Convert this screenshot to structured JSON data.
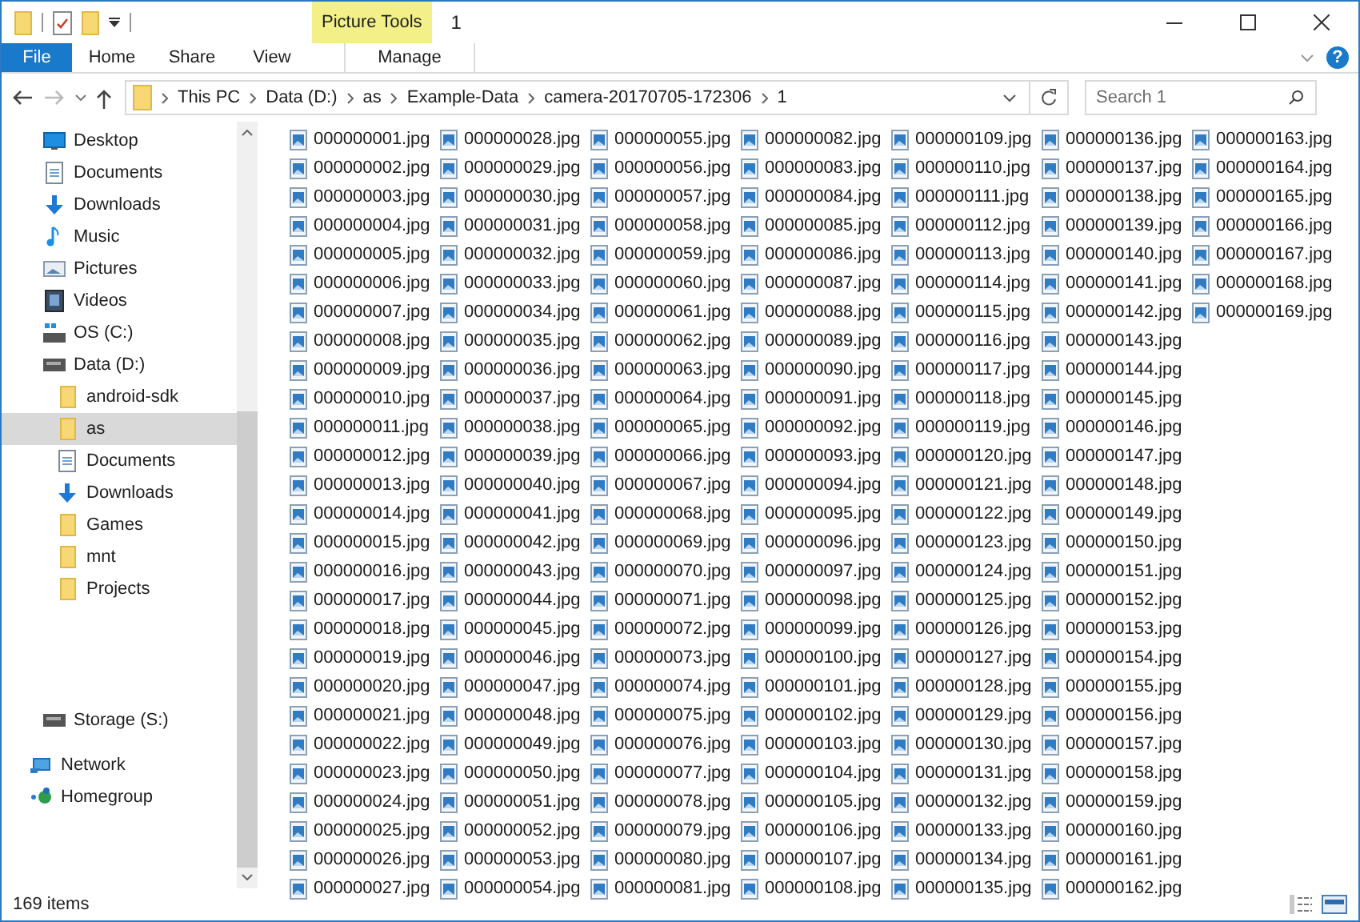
{
  "window": {
    "title": "1",
    "context_group": "Picture Tools",
    "help": "?"
  },
  "ribbon_tabs": [
    {
      "label": "File",
      "kind": "file"
    },
    {
      "label": "Home",
      "kind": "tab"
    },
    {
      "label": "Share",
      "kind": "tab"
    },
    {
      "label": "View",
      "kind": "tab"
    },
    {
      "label": "Manage",
      "kind": "context"
    }
  ],
  "address": {
    "breadcrumbs": [
      "This PC",
      "Data (D:)",
      "as",
      "Example-Data",
      "camera-20170705-172306",
      "1"
    ]
  },
  "search": {
    "placeholder": "Search 1"
  },
  "nav": {
    "groups": [
      {
        "items": [
          {
            "label": "Desktop",
            "kind": "desktop",
            "selected": false
          },
          {
            "label": "Documents",
            "kind": "document",
            "selected": false
          },
          {
            "label": "Downloads",
            "kind": "download",
            "selected": false
          },
          {
            "label": "Music",
            "kind": "music",
            "selected": false
          },
          {
            "label": "Pictures",
            "kind": "pictures",
            "selected": false
          },
          {
            "label": "Videos",
            "kind": "videos",
            "selected": false
          },
          {
            "label": "OS (C:)",
            "kind": "osdrive",
            "selected": false
          },
          {
            "label": "Data (D:)",
            "kind": "drive",
            "selected": false,
            "children": [
              {
                "label": "android-sdk",
                "kind": "folder",
                "selected": false
              },
              {
                "label": "as",
                "kind": "folder",
                "selected": true
              },
              {
                "label": "Documents",
                "kind": "document",
                "selected": false
              },
              {
                "label": "Downloads",
                "kind": "download",
                "selected": false
              },
              {
                "label": "Games",
                "kind": "folder",
                "selected": false
              },
              {
                "label": "mnt",
                "kind": "folder",
                "selected": false
              },
              {
                "label": "Projects",
                "kind": "folder",
                "selected": false
              }
            ]
          }
        ]
      },
      {
        "items": [
          {
            "label": "Storage (S:)",
            "kind": "drive",
            "selected": false
          }
        ]
      },
      {
        "items": [
          {
            "label": "Network",
            "kind": "network",
            "selected": false
          },
          {
            "label": "Homegroup",
            "kind": "homegroup",
            "selected": false
          }
        ]
      }
    ]
  },
  "files": [
    "000000001.jpg",
    "000000002.jpg",
    "000000003.jpg",
    "000000004.jpg",
    "000000005.jpg",
    "000000006.jpg",
    "000000007.jpg",
    "000000008.jpg",
    "000000009.jpg",
    "000000010.jpg",
    "000000011.jpg",
    "000000012.jpg",
    "000000013.jpg",
    "000000014.jpg",
    "000000015.jpg",
    "000000016.jpg",
    "000000017.jpg",
    "000000018.jpg",
    "000000019.jpg",
    "000000020.jpg",
    "000000021.jpg",
    "000000022.jpg",
    "000000023.jpg",
    "000000024.jpg",
    "000000025.jpg",
    "000000026.jpg",
    "000000027.jpg",
    "000000028.jpg",
    "000000029.jpg",
    "000000030.jpg",
    "000000031.jpg",
    "000000032.jpg",
    "000000033.jpg",
    "000000034.jpg",
    "000000035.jpg",
    "000000036.jpg",
    "000000037.jpg",
    "000000038.jpg",
    "000000039.jpg",
    "000000040.jpg",
    "000000041.jpg",
    "000000042.jpg",
    "000000043.jpg",
    "000000044.jpg",
    "000000045.jpg",
    "000000046.jpg",
    "000000047.jpg",
    "000000048.jpg",
    "000000049.jpg",
    "000000050.jpg",
    "000000051.jpg",
    "000000052.jpg",
    "000000053.jpg",
    "000000054.jpg",
    "000000055.jpg",
    "000000056.jpg",
    "000000057.jpg",
    "000000058.jpg",
    "000000059.jpg",
    "000000060.jpg",
    "000000061.jpg",
    "000000062.jpg",
    "000000063.jpg",
    "000000064.jpg",
    "000000065.jpg",
    "000000066.jpg",
    "000000067.jpg",
    "000000068.jpg",
    "000000069.jpg",
    "000000070.jpg",
    "000000071.jpg",
    "000000072.jpg",
    "000000073.jpg",
    "000000074.jpg",
    "000000075.jpg",
    "000000076.jpg",
    "000000077.jpg",
    "000000078.jpg",
    "000000079.jpg",
    "000000080.jpg",
    "000000081.jpg",
    "000000082.jpg",
    "000000083.jpg",
    "000000084.jpg",
    "000000085.jpg",
    "000000086.jpg",
    "000000087.jpg",
    "000000088.jpg",
    "000000089.jpg",
    "000000090.jpg",
    "000000091.jpg",
    "000000092.jpg",
    "000000093.jpg",
    "000000094.jpg",
    "000000095.jpg",
    "000000096.jpg",
    "000000097.jpg",
    "000000098.jpg",
    "000000099.jpg",
    "000000100.jpg",
    "000000101.jpg",
    "000000102.jpg",
    "000000103.jpg",
    "000000104.jpg",
    "000000105.jpg",
    "000000106.jpg",
    "000000107.jpg",
    "000000108.jpg",
    "000000109.jpg",
    "000000110.jpg",
    "000000111.jpg",
    "000000112.jpg",
    "000000113.jpg",
    "000000114.jpg",
    "000000115.jpg",
    "000000116.jpg",
    "000000117.jpg",
    "000000118.jpg",
    "000000119.jpg",
    "000000120.jpg",
    "000000121.jpg",
    "000000122.jpg",
    "000000123.jpg",
    "000000124.jpg",
    "000000125.jpg",
    "000000126.jpg",
    "000000127.jpg",
    "000000128.jpg",
    "000000129.jpg",
    "000000130.jpg",
    "000000131.jpg",
    "000000132.jpg",
    "000000133.jpg",
    "000000134.jpg",
    "000000135.jpg",
    "000000136.jpg",
    "000000137.jpg",
    "000000138.jpg",
    "000000139.jpg",
    "000000140.jpg",
    "000000141.jpg",
    "000000142.jpg",
    "000000143.jpg",
    "000000144.jpg",
    "000000145.jpg",
    "000000146.jpg",
    "000000147.jpg",
    "000000148.jpg",
    "000000149.jpg",
    "000000150.jpg",
    "000000151.jpg",
    "000000152.jpg",
    "000000153.jpg",
    "000000154.jpg",
    "000000155.jpg",
    "000000156.jpg",
    "000000157.jpg",
    "000000158.jpg",
    "000000159.jpg",
    "000000160.jpg",
    "000000161.jpg",
    "000000162.jpg",
    "000000163.jpg",
    "000000164.jpg",
    "000000165.jpg",
    "000000166.jpg",
    "000000167.jpg",
    "000000168.jpg",
    "000000169.jpg"
  ],
  "status_bar": {
    "item_count": "169 items"
  }
}
